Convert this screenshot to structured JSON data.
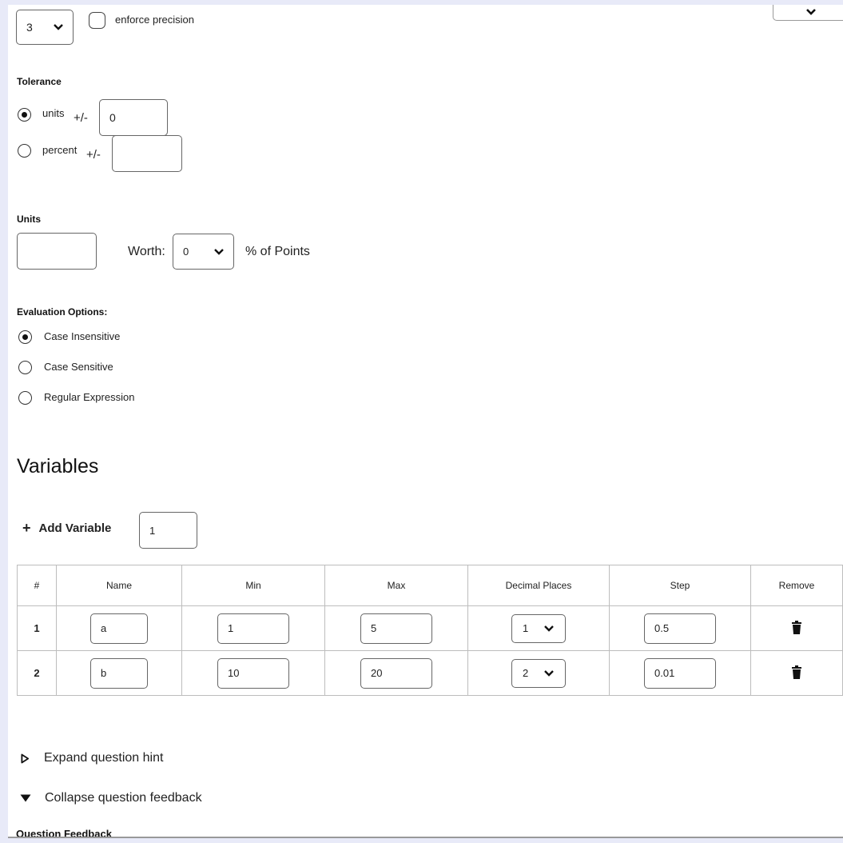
{
  "precision": {
    "select_value": "3",
    "enforce_label": "enforce precision"
  },
  "tolerance": {
    "heading": "Tolerance",
    "units_label": "units",
    "units_pm": "+/-",
    "units_value": "0",
    "percent_label": "percent",
    "percent_pm": "+/-",
    "percent_value": ""
  },
  "units": {
    "heading": "Units",
    "units_value": "",
    "worth_label": "Worth:",
    "worth_value": "0",
    "points_label": "% of Points"
  },
  "evaluation": {
    "heading": "Evaluation Options:",
    "options": [
      "Case Insensitive",
      "Case Sensitive",
      "Regular Expression"
    ],
    "selected": "Case Insensitive"
  },
  "variables": {
    "heading": "Variables",
    "add_label": "Add Variable",
    "add_plus": "+",
    "add_count": "1",
    "columns": [
      "#",
      "Name",
      "Min",
      "Max",
      "Decimal Places",
      "Step",
      "Remove"
    ],
    "rows": [
      {
        "num": "1",
        "name": "a",
        "min": "1",
        "max": "5",
        "decimal": "1",
        "step": "0.5"
      },
      {
        "num": "2",
        "name": "b",
        "min": "10",
        "max": "20",
        "decimal": "2",
        "step": "0.01"
      }
    ]
  },
  "hint": {
    "label": "Expand question hint"
  },
  "feedback": {
    "label": "Collapse question feedback",
    "section_heading": "Question Feedback"
  },
  "icons": {
    "chevron": "chevron-down-icon",
    "trash": "trash-icon",
    "expand": "triangle-right-outline-icon",
    "collapse": "triangle-down-filled-icon"
  },
  "colors": {
    "background": "#e8eaf8",
    "border": "#666666",
    "table_border": "#bdbdbd"
  }
}
